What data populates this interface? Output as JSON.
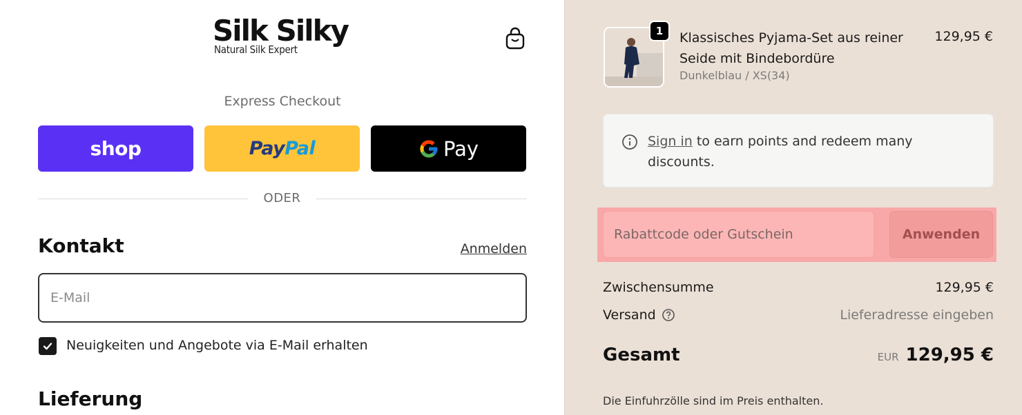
{
  "brand": {
    "name": "Silk Silky",
    "tagline": "Natural Silk Expert"
  },
  "header": {
    "cart_icon": "shopping-bag-icon"
  },
  "express": {
    "title": "Express Checkout",
    "shop_label": "shop",
    "paypal_part1": "Pay",
    "paypal_part2": "Pal",
    "gpay_label": "Pay",
    "divider": "ODER",
    "colors": {
      "shop": "#5a31f4",
      "paypal": "#ffc439",
      "gpay": "#000000"
    }
  },
  "contact": {
    "heading": "Kontakt",
    "login_link": "Anmelden",
    "email_placeholder": "E-Mail",
    "email_value": "",
    "newsletter_label": "Neuigkeiten und Angebote via E-Mail erhalten",
    "newsletter_checked": true
  },
  "delivery": {
    "heading": "Lieferung"
  },
  "summary": {
    "product": {
      "quantity": "1",
      "name": "Klassisches Pyjama-Set aus reiner Seide mit Bindebordüre",
      "variant": "Dunkelblau / XS(34)",
      "price": "129,95 €"
    },
    "info": {
      "signin_link": "Sign in",
      "text": " to earn points and redeem many discounts."
    },
    "discount": {
      "placeholder": "Rabattcode oder Gutschein",
      "apply_label": "Anwenden"
    },
    "subtotal_label": "Zwischensumme",
    "subtotal_value": "129,95 €",
    "shipping_label": "Versand",
    "shipping_value": "Lieferadresse eingeben",
    "total_label": "Gesamt",
    "total_currency": "EUR",
    "total_value": "129,95 €",
    "duties_note": "Die Einfuhrzölle sind im Preis enthalten."
  }
}
